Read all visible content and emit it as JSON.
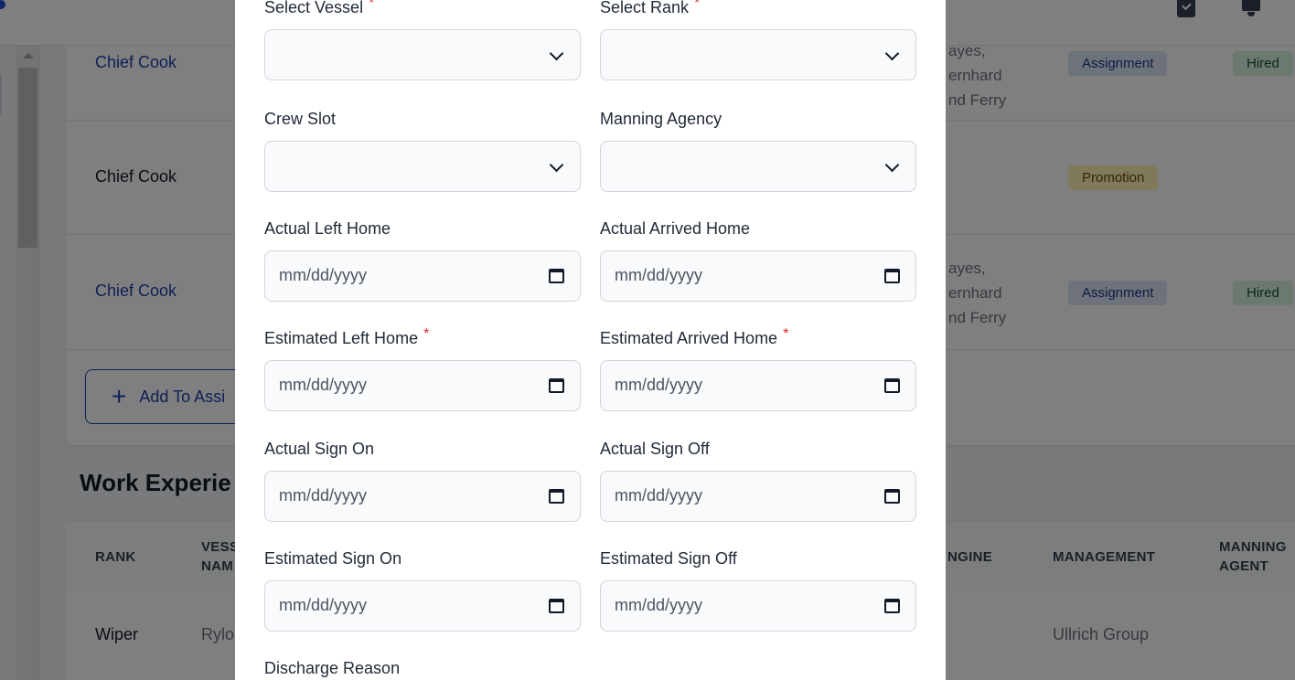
{
  "topbar": {
    "icons": [
      "todo-check-icon",
      "bell-icon"
    ]
  },
  "assignments": {
    "rows": [
      {
        "rank": "Chief Cook",
        "rank_is_link": true,
        "people": "ayes,\nernhard\nnd Ferry",
        "people_partial_top": true,
        "type": "Assignment",
        "status": "Hired"
      },
      {
        "rank": "Chief Cook",
        "rank_is_link": false,
        "people": "",
        "type": "Promotion",
        "status": ""
      },
      {
        "rank": "Chief Cook",
        "rank_is_link": true,
        "people": "ayes,\nernhard\nnd Ferry",
        "type": "Assignment",
        "status": "Hired"
      }
    ],
    "add_button_label": "Add To Assi",
    "add_button_icon": "plus-icon"
  },
  "work_experience": {
    "title": "Work Experie",
    "columns": [
      "RANK",
      "VESS\nNAM",
      "NGINE",
      "MANAGEMENT",
      "MANNING\nAGENT"
    ],
    "rows": [
      {
        "rank": "Wiper",
        "vessel_name": "Rylo",
        "management": "Ullrich Group"
      }
    ]
  },
  "modal": {
    "fields": [
      {
        "id": "select-vessel",
        "label": "Select Vessel",
        "required": true,
        "type": "select",
        "value": ""
      },
      {
        "id": "select-rank",
        "label": "Select Rank",
        "required": true,
        "type": "select",
        "value": ""
      },
      {
        "id": "crew-slot",
        "label": "Crew Slot",
        "required": false,
        "type": "select",
        "value": ""
      },
      {
        "id": "manning-agency",
        "label": "Manning Agency",
        "required": false,
        "type": "select",
        "value": ""
      },
      {
        "id": "actual-left-home",
        "label": "Actual Left Home",
        "required": false,
        "type": "date",
        "placeholder": "mm/dd/yyyy"
      },
      {
        "id": "actual-arrived-home",
        "label": "Actual Arrived Home",
        "required": false,
        "type": "date",
        "placeholder": "mm/dd/yyyy"
      },
      {
        "id": "estimated-left-home",
        "label": "Estimated Left Home",
        "required": true,
        "type": "date",
        "placeholder": "mm/dd/yyyy"
      },
      {
        "id": "estimated-arrived-home",
        "label": "Estimated Arrived Home",
        "required": true,
        "type": "date",
        "placeholder": "mm/dd/yyyy"
      },
      {
        "id": "actual-sign-on",
        "label": "Actual Sign On",
        "required": false,
        "type": "date",
        "placeholder": "mm/dd/yyyy"
      },
      {
        "id": "actual-sign-off",
        "label": "Actual Sign Off",
        "required": false,
        "type": "date",
        "placeholder": "mm/dd/yyyy"
      },
      {
        "id": "estimated-sign-on",
        "label": "Estimated Sign On",
        "required": false,
        "type": "date",
        "placeholder": "mm/dd/yyyy"
      },
      {
        "id": "estimated-sign-off",
        "label": "Estimated Sign Off",
        "required": false,
        "type": "date",
        "placeholder": "mm/dd/yyyy"
      },
      {
        "id": "discharge-reason",
        "label": "Discharge Reason",
        "required": false,
        "type": "text"
      }
    ],
    "required_marker": "*"
  },
  "colors": {
    "link": "#1e40af",
    "required": "#dc2626",
    "badge_assignment_bg": "#dbe4f7",
    "badge_promotion_bg": "#fdf5b4",
    "badge_hired_bg": "#d6f2dc",
    "overlay": "rgba(0,0,0,0.5)"
  }
}
